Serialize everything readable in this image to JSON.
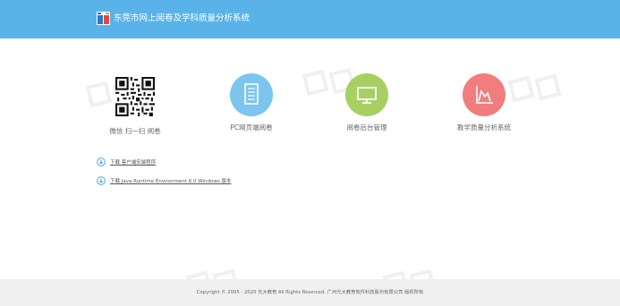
{
  "header": {
    "title": "东莞市网上阅卷及学科质量分析系统",
    "bg_color": "#5ab3e8",
    "logo_icon": "book-logo-icon"
  },
  "tiles": [
    {
      "label": "微信 扫一扫 阅卷",
      "icon": "qr-code-icon"
    },
    {
      "label": "PC网页端阅卷",
      "icon": "document-icon",
      "color": "#7cc5ef"
    },
    {
      "label": "阅卷后台管理",
      "icon": "monitor-icon",
      "color": "#a8cf62"
    },
    {
      "label": "教学质量分析系统",
      "icon": "chart-icon",
      "color": "#f27d7d"
    }
  ],
  "downloads": [
    {
      "label": "下载 客户端安装程序",
      "icon": "download-icon"
    },
    {
      "label": "下载 Java Runtime Environment 6.0 Windows 版本",
      "icon": "download-icon"
    }
  ],
  "footer": {
    "copyright": "Copyright © 2005 - 2020 光大教育 All Rights Reserved. 广州光大教育软件科技股份有限公司 版权所有",
    "bg_color": "#f0f0f0"
  }
}
